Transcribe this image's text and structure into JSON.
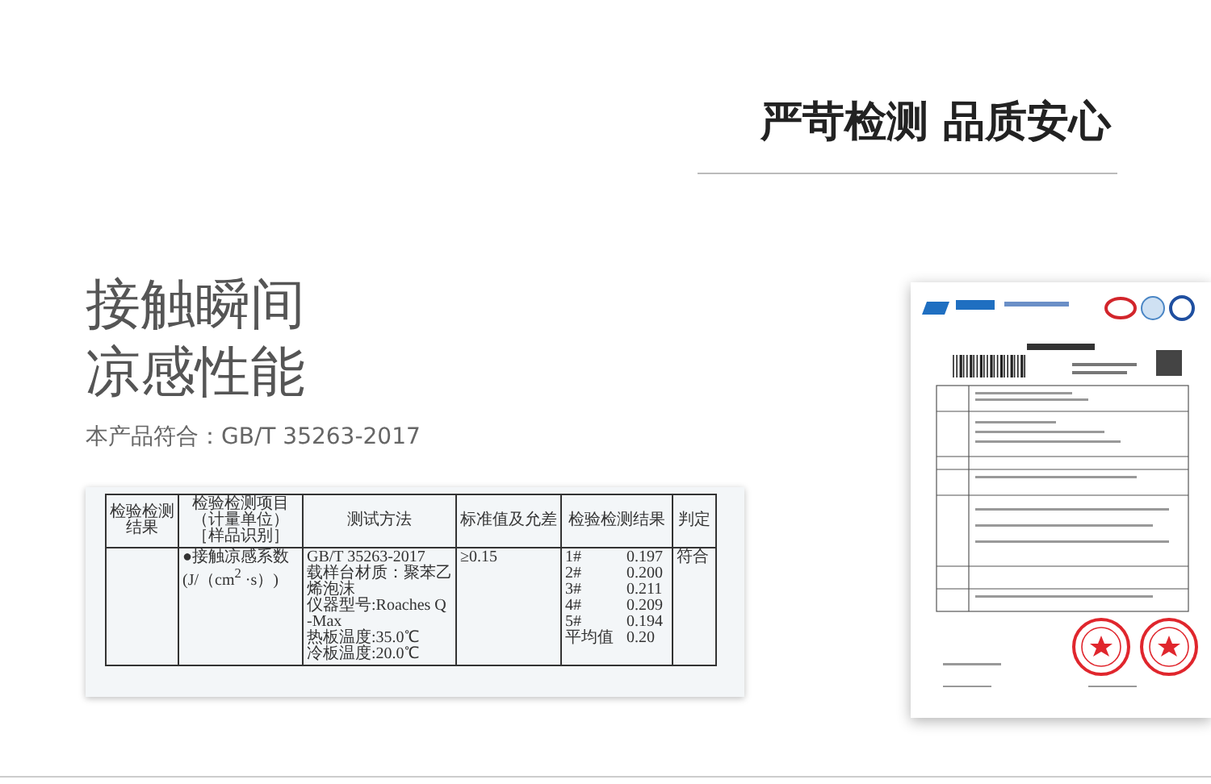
{
  "headline": "严苛检测 品质安心",
  "feature": {
    "title_lines": [
      "接触瞬间",
      "凉感性能"
    ],
    "standard": "本产品符合：GB/T 35263-2017"
  },
  "report_excerpt": {
    "columns": [
      {
        "lines": [
          "检验检测",
          "结果"
        ]
      },
      {
        "lines": [
          "检验检测项目",
          "（计量单位）",
          "［样品识别］"
        ]
      },
      {
        "lines": [
          "测试方法"
        ]
      },
      {
        "lines": [
          "标准值及允差"
        ]
      },
      {
        "lines": [
          "检验检测结果"
        ]
      },
      {
        "lines": [
          "判定"
        ]
      }
    ],
    "row": {
      "item": [
        "●接触凉感系数",
        "(J/（cm$^{2}$ ·s）)"
      ],
      "method": [
        "GB/T 35263-2017",
        "载样台材质：聚苯乙",
        "烯泡沫",
        "仪器型号:Roaches Q",
        "-Max",
        "热板温度:35.0℃",
        "冷板温度:20.0℃"
      ],
      "standard": "≥0.15",
      "results": [
        {
          "label": "1#",
          "value": "0.197"
        },
        {
          "label": "2#",
          "value": "0.200"
        },
        {
          "label": "3#",
          "value": "0.211"
        },
        {
          "label": "4#",
          "value": "0.209"
        },
        {
          "label": "5#",
          "value": "0.194"
        },
        {
          "label": "平均值",
          "value": "0.20"
        }
      ],
      "verdict": "符合"
    }
  }
}
